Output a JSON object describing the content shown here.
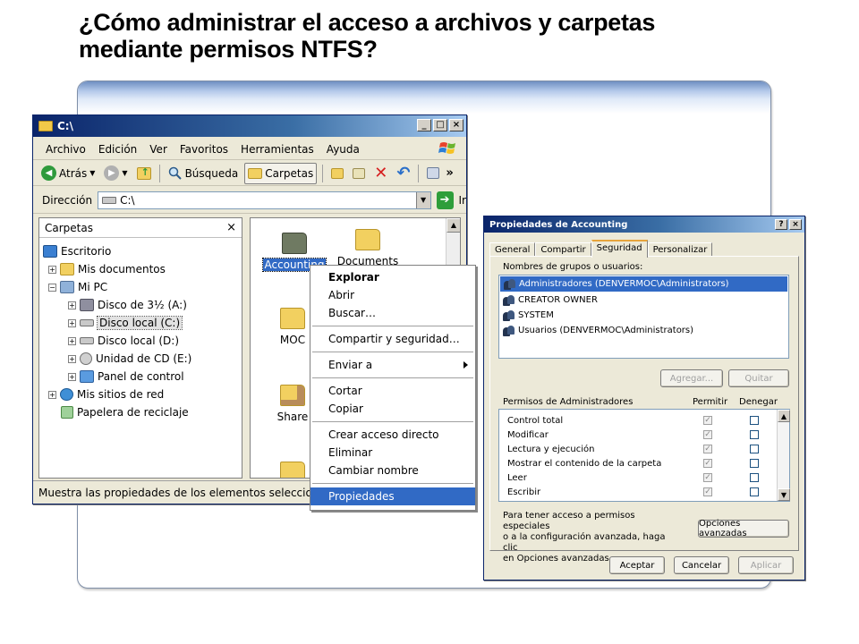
{
  "slide": {
    "title_line1": "¿Cómo administrar el acceso a archivos y carpetas",
    "title_line2": "mediante permisos NTFS?"
  },
  "explorer": {
    "title": "C:\\",
    "window_buttons": [
      "_",
      "□",
      "×"
    ],
    "menu": [
      "Archivo",
      "Edición",
      "Ver",
      "Favoritos",
      "Herramientas",
      "Ayuda"
    ],
    "toolbar": {
      "back": "Atrás",
      "search": "Búsqueda",
      "folders": "Carpetas",
      "more": "»"
    },
    "address": {
      "label": "Dirección",
      "value": "C:\\",
      "go": "Ir"
    },
    "folder_pane": {
      "title": "Carpetas",
      "close": "×",
      "items": [
        {
          "label": "Escritorio",
          "expander": ""
        },
        {
          "label": "Mis documentos",
          "expander": "+"
        },
        {
          "label": "Mi PC",
          "expander": "−"
        },
        {
          "label": "Disco de 3½ (A:)",
          "expander": "+"
        },
        {
          "label": "Disco local (C:)",
          "expander": "+"
        },
        {
          "label": "Disco local (D:)",
          "expander": "+"
        },
        {
          "label": "Unidad de CD (E:)",
          "expander": "+"
        },
        {
          "label": "Panel de control",
          "expander": "+"
        },
        {
          "label": "Mis sitios de red",
          "expander": "+"
        },
        {
          "label": "Papelera de reciclaje",
          "expander": ""
        }
      ]
    },
    "files": [
      {
        "label": "Accounting"
      },
      {
        "label": "Documents"
      },
      {
        "label": "MOC"
      },
      {
        "label": "Share"
      },
      {
        "label": ""
      }
    ],
    "status": "Muestra las propiedades de los elementos seleccionados."
  },
  "context_menu": {
    "items": [
      {
        "label": "Explorar",
        "bold": true
      },
      {
        "label": "Abrir"
      },
      {
        "label": "Buscar…"
      },
      {
        "label": "Compartir y seguridad…"
      },
      {
        "label": "Enviar a"
      },
      {
        "label": "Cortar"
      },
      {
        "label": "Copiar"
      },
      {
        "label": "Crear acceso directo"
      },
      {
        "label": "Eliminar"
      },
      {
        "label": "Cambiar nombre"
      },
      {
        "label": "Propiedades",
        "highlighted": true
      }
    ]
  },
  "properties": {
    "title": "Propiedades de Accounting",
    "title_buttons": [
      "?",
      "×"
    ],
    "tabs": [
      "General",
      "Compartir",
      "Seguridad",
      "Personalizar"
    ],
    "active_tab": "Seguridad",
    "groups_label": "Nombres de grupos o usuarios:",
    "users": [
      "Administradores (DENVERMOC\\Administrators)",
      "CREATOR OWNER",
      "SYSTEM",
      "Usuarios (DENVERMOC\\Administrators)"
    ],
    "add_button": "Agregar...",
    "remove_button": "Quitar",
    "permissions_label": "Permisos de Administradores",
    "allow_label": "Permitir",
    "deny_label": "Denegar",
    "permissions": [
      {
        "name": "Control total",
        "allow": true,
        "deny": false
      },
      {
        "name": "Modificar",
        "allow": true,
        "deny": false
      },
      {
        "name": "Lectura y ejecución",
        "allow": true,
        "deny": false
      },
      {
        "name": "Mostrar el contenido de la carpeta",
        "allow": true,
        "deny": false
      },
      {
        "name": "Leer",
        "allow": true,
        "deny": false
      },
      {
        "name": "Escribir",
        "allow": true,
        "deny": false
      }
    ],
    "info_line1": "Para tener acceso a permisos especiales",
    "info_line2": "o a la configuración avanzada, haga clic",
    "info_line3": "en Opciones avanzadas.",
    "advanced_button": "Opciones avanzadas",
    "ok_button": "Aceptar",
    "cancel_button": "Cancelar",
    "apply_button": "Aplicar"
  },
  "colors": {
    "titlebar": "#0a246a",
    "selection": "#316ac5",
    "window_face": "#ece9d8",
    "frame_band": "#6f8fc2"
  }
}
